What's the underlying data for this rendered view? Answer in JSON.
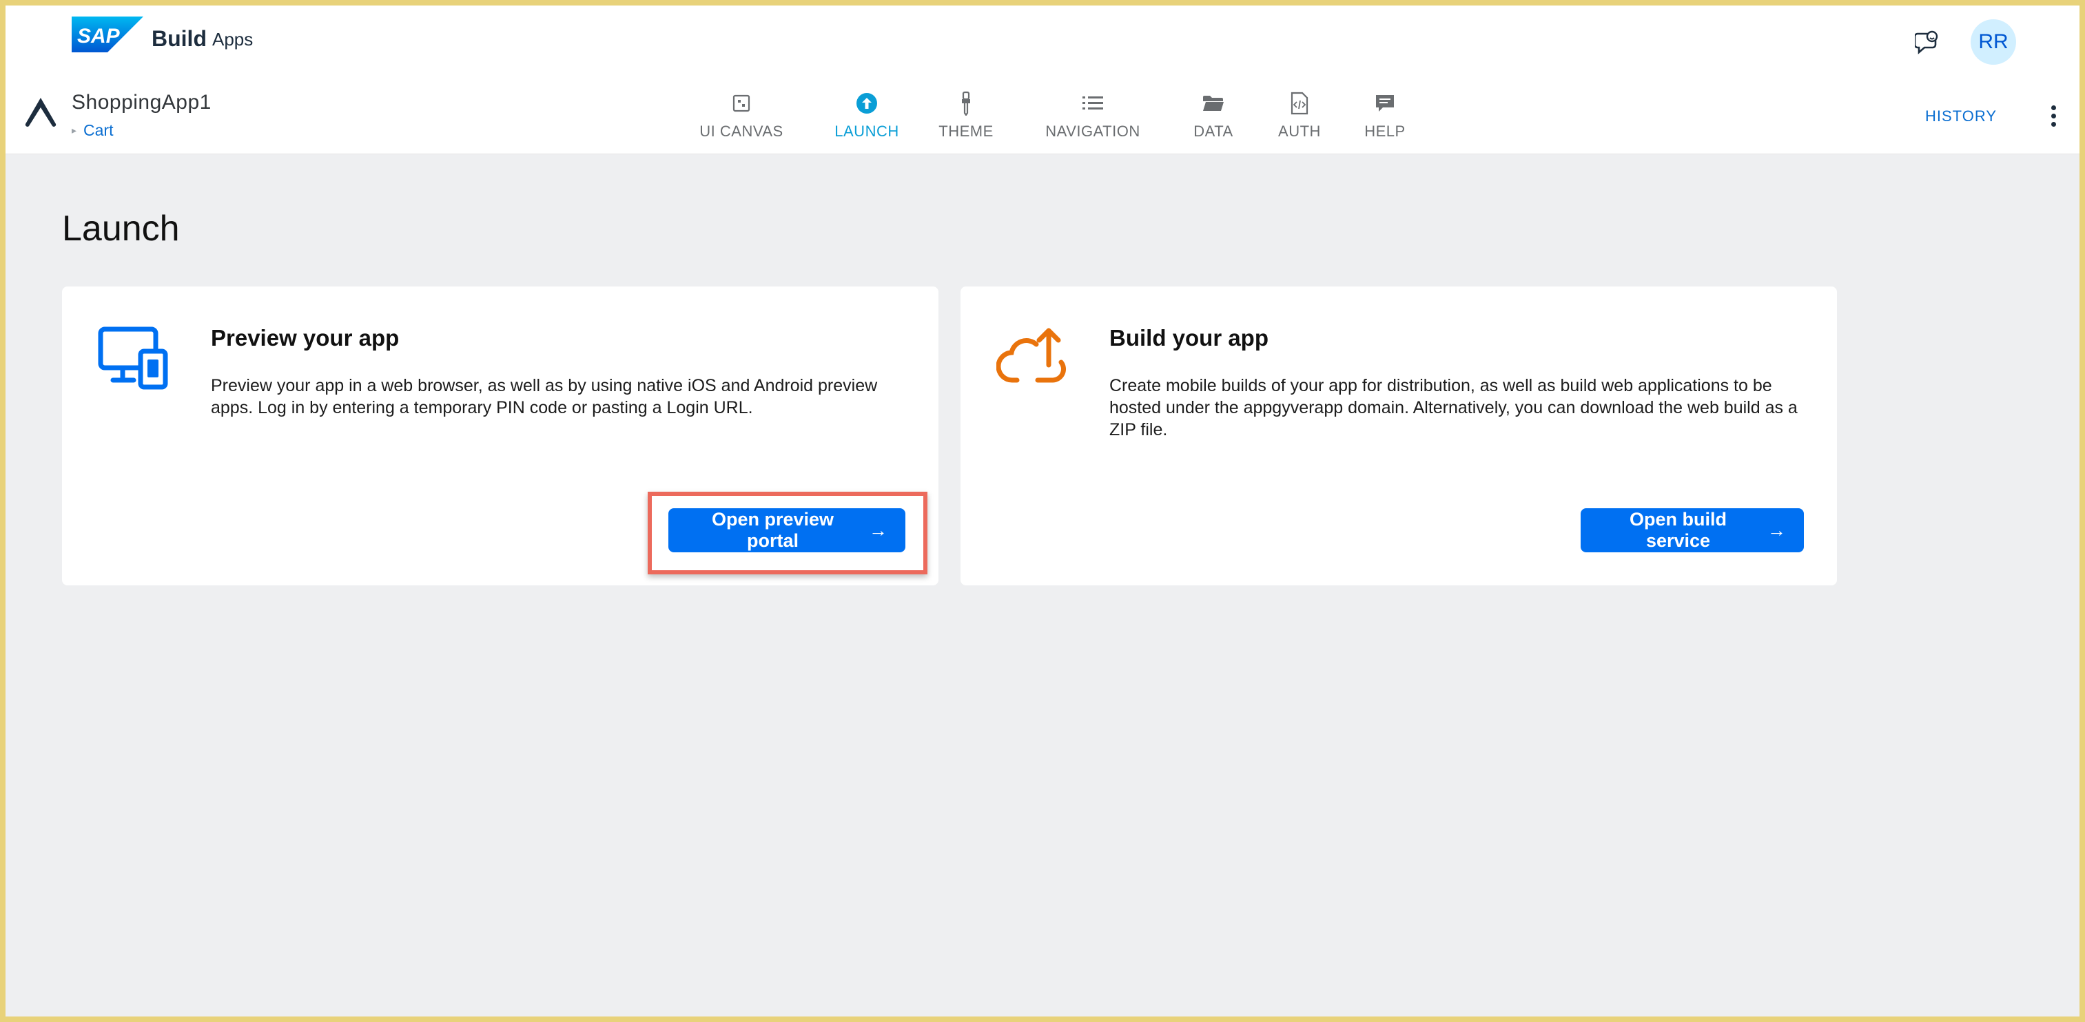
{
  "shell": {
    "brand_title": "Build",
    "brand_sub": "Apps",
    "logo_text": "SAP",
    "avatar_initials": "RR"
  },
  "app": {
    "name": "ShoppingApp1",
    "breadcrumb": "Cart"
  },
  "tabs": [
    {
      "label": "UI CANVAS",
      "icon": "canvas-icon"
    },
    {
      "label": "LAUNCH",
      "icon": "launch-icon",
      "active": true
    },
    {
      "label": "THEME",
      "icon": "theme-brush-icon"
    },
    {
      "label": "NAVIGATION",
      "icon": "list-icon"
    },
    {
      "label": "DATA",
      "icon": "folder-icon"
    },
    {
      "label": "AUTH",
      "icon": "code-doc-icon"
    },
    {
      "label": "HELP",
      "icon": "chat-icon"
    }
  ],
  "header_actions": {
    "history_label": "HISTORY"
  },
  "page": {
    "title": "Launch"
  },
  "cards": [
    {
      "title": "Preview your app",
      "description": "Preview your app in a web browser, as well as by using native iOS and Android preview apps. Log in by entering a temporary PIN code or pasting a Login URL.",
      "button_label": "Open preview portal",
      "icon": "devices-icon"
    },
    {
      "title": "Build your app",
      "description": "Create mobile builds of your app for distribution, as well as build web applications to be hosted under the appgyverapp domain. Alternatively, you can download the web build as a ZIP file.",
      "button_label": "Open build service",
      "icon": "cloud-upload-icon"
    }
  ],
  "colors": {
    "accent": "#0070f2",
    "active_tab": "#0a9ed6",
    "build_icon": "#e9730c",
    "highlight": "#ec6a5c",
    "background": "#eeeff1"
  }
}
